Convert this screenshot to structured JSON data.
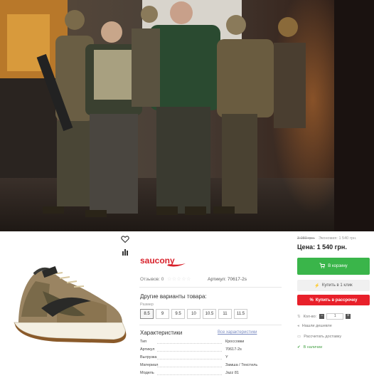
{
  "product": {
    "brand": "saucony",
    "reviews_label": "Отзывов: 0",
    "stars": "☆☆☆☆☆",
    "sku_label": "Артикул: 70617-2s",
    "variants_title": "Другие варианты товара:",
    "size_caption": "Размер",
    "sizes": [
      "8.5",
      "9",
      "9.5",
      "10",
      "10.5",
      "11",
      "11.5"
    ],
    "selected_size": "8.5",
    "characteristics_title": "Характеристики",
    "all_characteristics_link": "Все характеристики",
    "characteristics": [
      {
        "key": "Тип",
        "value": "Кроссовки"
      },
      {
        "key": "Артикул",
        "value": "70617-2s"
      },
      {
        "key": "Выгрузка",
        "value": "Y"
      },
      {
        "key": "Материал",
        "value": "Замша / Текстиль"
      },
      {
        "key": "Модель",
        "value": "Jazz 81"
      }
    ]
  },
  "purchase": {
    "old_price": "3 080 грн.",
    "saving": "Экономия: 1 540 грн.",
    "price_label": "Цена: 1 540 грн.",
    "cart_button": "В корзину",
    "one_click_button": "Купить в 1 клик",
    "installment_button": "Купить в рассрочку",
    "quantity_label": "Кол-во:",
    "quantity_value": "1",
    "cheaper_link": "Нашли дешевле",
    "delivery_link": "Рассчитать доставку",
    "stock_status": "В наличии"
  },
  "colors": {
    "cart_green": "#3ab54a",
    "installment_red": "#e8202a",
    "brand_red": "#d8212b"
  }
}
